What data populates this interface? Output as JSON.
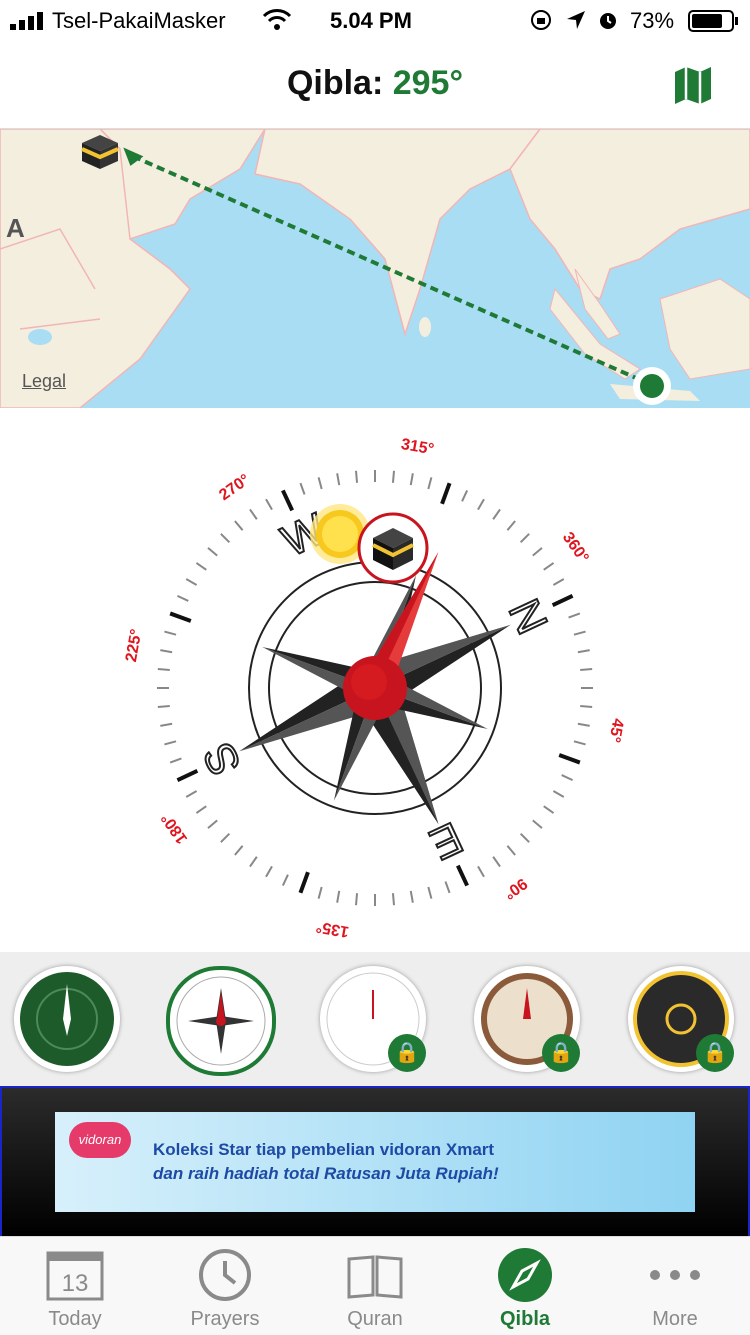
{
  "status_bar": {
    "carrier": "Tsel-PakaiMasker",
    "time": "5.04 PM",
    "battery": "73%"
  },
  "header": {
    "title_prefix": "Qibla:",
    "bearing": "295°"
  },
  "map": {
    "region_label": "A",
    "legal_label": "Legal"
  },
  "compass": {
    "degree_labels": [
      "270°",
      "315°",
      "360°",
      "45°",
      "90°",
      "135°",
      "180°",
      "225°"
    ],
    "cardinals": [
      "N",
      "E",
      "S",
      "W"
    ]
  },
  "compass_styles": [
    {
      "name": "green",
      "locked": false,
      "selected": false
    },
    {
      "name": "classic-red",
      "locked": false,
      "selected": true
    },
    {
      "name": "minimal-white",
      "locked": true,
      "selected": false
    },
    {
      "name": "wood",
      "locked": true,
      "selected": false
    },
    {
      "name": "dark-gold",
      "locked": true,
      "selected": false
    }
  ],
  "ad": {
    "brand": "vidoran",
    "line1": "Koleksi Star tiap pembelian vidoran Xmart",
    "line2": "dan raih hadiah total Ratusan Juta Rupiah!"
  },
  "tabs": [
    {
      "label": "Today",
      "icon": "calendar-icon",
      "badge": "13",
      "active": false
    },
    {
      "label": "Prayers",
      "icon": "clock-icon",
      "active": false
    },
    {
      "label": "Quran",
      "icon": "book-icon",
      "active": false
    },
    {
      "label": "Qibla",
      "icon": "compass-icon",
      "active": true
    },
    {
      "label": "More",
      "icon": "more-dots-icon",
      "active": false
    }
  ],
  "colors": {
    "accent": "#1e7a35",
    "needle": "#c8141e",
    "degree_label": "#e0141e",
    "map_water": "#a9ddf3",
    "map_land": "#f4eedf"
  }
}
